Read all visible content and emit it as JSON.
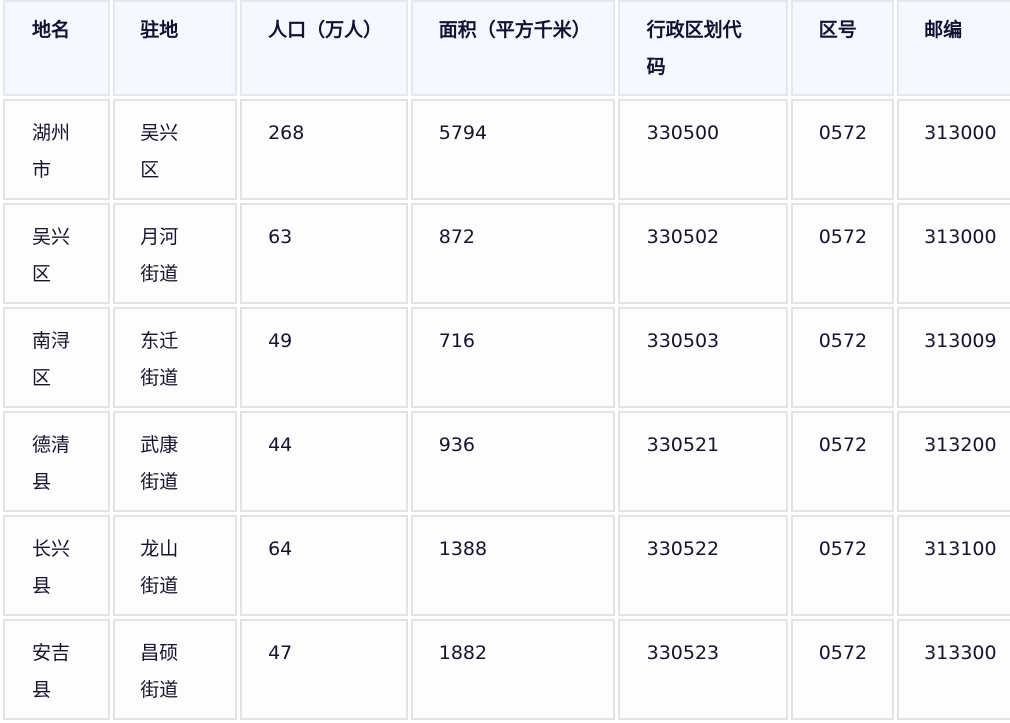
{
  "table": {
    "headers": [
      "地名",
      "驻地",
      "人口（万人）",
      "面积（平方千米）",
      "行政区划代码",
      "区号",
      "邮编"
    ],
    "rows": [
      [
        "湖州市",
        "吴兴区",
        "268",
        "5794",
        "330500",
        "0572",
        "313000"
      ],
      [
        "吴兴区",
        "月河街道",
        "63",
        "872",
        "330502",
        "0572",
        "313000"
      ],
      [
        "南浔区",
        "东迁街道",
        "49",
        "716",
        "330503",
        "0572",
        "313009"
      ],
      [
        "德清县",
        "武康街道",
        "44",
        "936",
        "330521",
        "0572",
        "313200"
      ],
      [
        "长兴县",
        "龙山街道",
        "64",
        "1388",
        "330522",
        "0572",
        "313100"
      ],
      [
        "安吉县",
        "昌硕街道",
        "47",
        "1882",
        "330523",
        "0572",
        "313300"
      ]
    ]
  },
  "colors": {
    "header_background": "#f6f8ff",
    "cell_background": "#fdfdfd",
    "border": "#e3e3e3",
    "text": "#14142e"
  }
}
